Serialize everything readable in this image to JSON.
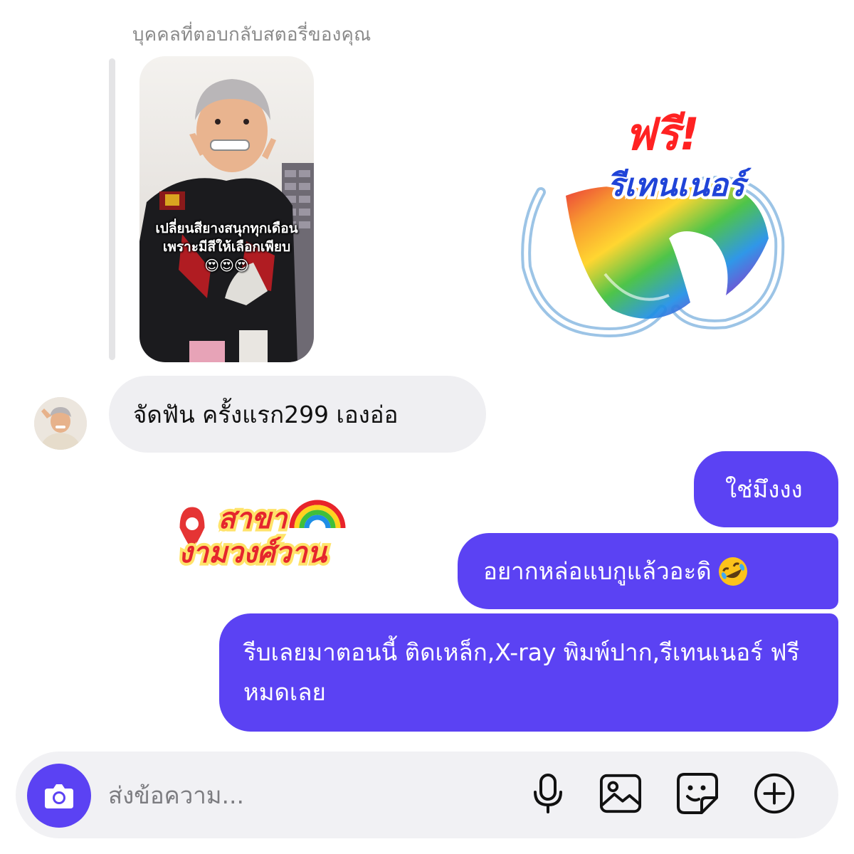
{
  "reply": {
    "caption": "บุคคลที่ตอบกลับสตอรี่ของคุณ",
    "story_caption_line1": "เปลี่ยนสียางสนุกทุกเดือน",
    "story_caption_line2": "เพราะมีสีให้เลือกเพียบ",
    "story_emoji": "😍😍😍"
  },
  "stickers": {
    "retainer_line1": "ฟรี!",
    "retainer_line2": "รีเทนเนอร์",
    "branch_line1": "สาขา",
    "branch_line2": "งามวงศ์วาน"
  },
  "messages": {
    "incoming": "จัดฟัน ครั้งแรก299 เองอ่อ",
    "outgoing_1": "ใช่มึงงง",
    "outgoing_2": "อยากหล่อแบกูแล้วอะดิ",
    "outgoing_3": "รีบเลยมาตอนนี้ ติดเหล็ก,X-ray พิมพ์ปาก,รีเทนเนอร์ ฟรีหมดเลย"
  },
  "composer": {
    "placeholder": "ส่งข้อความ..."
  },
  "colors": {
    "accent": "#5b42f3",
    "incoming_bubble": "#efeff2",
    "composer_bg": "#f1f1f4"
  },
  "icons": [
    "camera-icon",
    "microphone-icon",
    "image-icon",
    "sticker-icon",
    "plus-circle-icon",
    "pin-icon",
    "rainbow-icon",
    "rolling-laughing-emoji"
  ]
}
